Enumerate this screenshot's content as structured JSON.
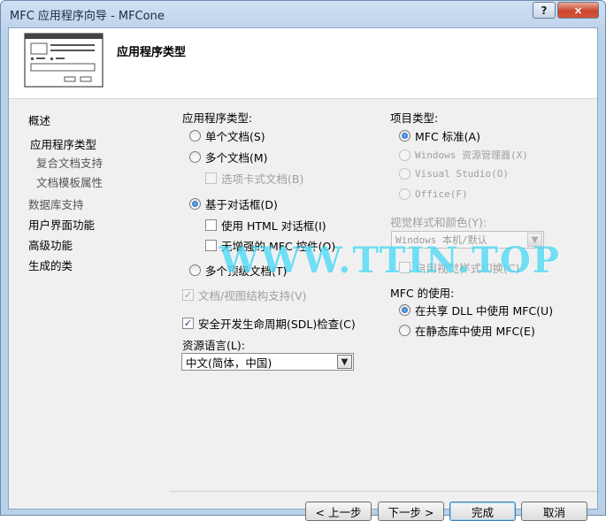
{
  "window": {
    "title": "MFC 应用程序向导 - MFCone",
    "help_label": "?",
    "close_label": "×"
  },
  "header": {
    "title": "应用程序类型"
  },
  "nav": [
    {
      "label": "概述"
    },
    {
      "label": "应用程序类型"
    },
    {
      "label": "复合文档支持"
    },
    {
      "label": "文档模板属性"
    },
    {
      "label": "数据库支持"
    },
    {
      "label": "用户界面功能"
    },
    {
      "label": "高级功能"
    },
    {
      "label": "生成的类"
    }
  ],
  "app_type": {
    "label": "应用程序类型:",
    "single_doc": "单个文档(S)",
    "multi_doc": "多个文档(M)",
    "tabbed_docs": "选项卡式文档(B)",
    "dialog_based": "基于对话框(D)",
    "html_dialog": "使用 HTML 对话框(I)",
    "no_enhanced_mfc": "无增强的 MFC 控件(O)",
    "multi_toplevel": "多个顶级文档(T)",
    "doc_view_support": "文档/视图结构支持(V)",
    "sdl_checks": "安全开发生命周期(SDL)检查(C)",
    "selected": "基于对话框(D)"
  },
  "resource_language": {
    "label": "资源语言(L):",
    "value": "中文(简体，中国)"
  },
  "project_type": {
    "label": "项目类型:",
    "mfc_standard": "MFC 标准(A)",
    "windows_explorer": "Windows 资源管理器(X)",
    "visual_studio": "Visual Studio(O)",
    "office": "Office(F)"
  },
  "visual_style": {
    "label": "视觉样式和颜色(Y):",
    "value": "Windows 本机/默认",
    "enable_switching": "启用视觉样式切换(C)"
  },
  "mfc_use": {
    "label": "MFC 的使用:",
    "shared_dll": "在共享 DLL 中使用 MFC(U)",
    "static_lib": "在静态库中使用 MFC(E)"
  },
  "buttons": {
    "prev": "< 上一步",
    "next": "下一步 >",
    "finish": "完成",
    "cancel": "取消"
  },
  "watermark": "WWW.TTIN.TOP"
}
